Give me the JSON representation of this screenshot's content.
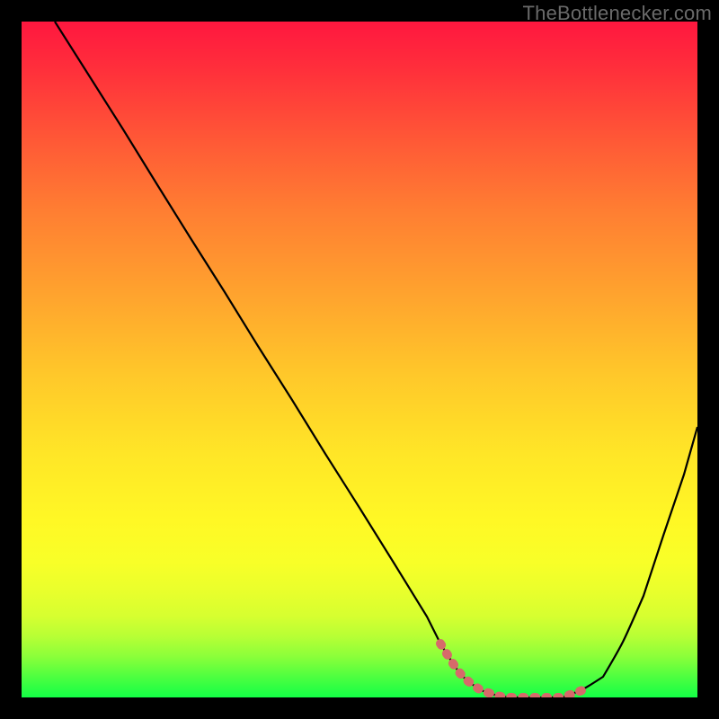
{
  "watermark": "TheBottlenecker.com",
  "colors": {
    "frame": "#000000",
    "watermark": "#6a6a6a",
    "curve": "#000000",
    "dotted_segment": "#d66a6a",
    "gradient_top": "#ff173f",
    "gradient_bottom": "#13ff46"
  },
  "chart_data": {
    "type": "line",
    "title": "",
    "xlabel": "",
    "ylabel": "",
    "xlim": [
      0,
      100
    ],
    "ylim": [
      0,
      100
    ],
    "axes_visible": false,
    "background": "vertical red-yellow-green gradient",
    "series": [
      {
        "name": "bottleneck-curve",
        "x": [
          5,
          10,
          15,
          20,
          25,
          30,
          35,
          40,
          45,
          50,
          55,
          60,
          62,
          65,
          68,
          71,
          74,
          77,
          80,
          83,
          86,
          89,
          92,
          95,
          98,
          100
        ],
        "values": [
          100,
          92,
          84,
          76,
          68,
          60,
          52,
          44,
          36,
          28,
          20,
          12,
          8,
          3,
          1,
          0,
          0,
          0,
          0,
          1,
          3,
          8,
          15,
          24,
          33,
          40
        ]
      }
    ],
    "highlight": {
      "name": "optimal-range-dots",
      "style": "dotted red",
      "x": [
        62,
        65,
        68,
        71,
        74,
        77,
        80,
        83
      ],
      "values": [
        8,
        3,
        1,
        0,
        0,
        0,
        0,
        1
      ]
    }
  }
}
